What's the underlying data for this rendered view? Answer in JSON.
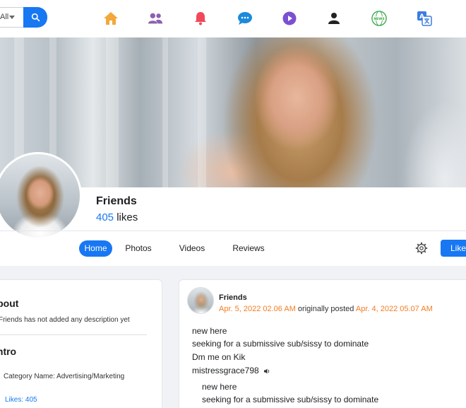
{
  "search": {
    "select_value": "All"
  },
  "nav": {
    "icons": [
      "home-icon",
      "friends-icon",
      "notifications-icon",
      "messages-icon",
      "video-icon",
      "profile-icon",
      "news-icon",
      "translate-icon"
    ],
    "news_badge": "NEWS"
  },
  "profile": {
    "name": "Friends",
    "likes_count": "405",
    "likes_label": "likes"
  },
  "tabs": [
    {
      "label": "Home",
      "active": true
    },
    {
      "label": "Photos",
      "active": false
    },
    {
      "label": "Videos",
      "active": false
    },
    {
      "label": "Reviews",
      "active": false
    }
  ],
  "like_button": "Like",
  "about": {
    "title": "About",
    "description": "Friends has not added any description yet",
    "intro_title": "Intro",
    "category": "Category Name: Advertising/Marketing",
    "likes": "Likes: 405"
  },
  "post": {
    "author": "Friends",
    "date_posted": "Apr. 5, 2022 02.06 AM",
    "originally_label": "originally posted",
    "date_original": "Apr. 4, 2022 05.07 AM",
    "lines": [
      "new here",
      "seeking for a submissive sub/sissy to dominate",
      "Dm me on Kik",
      "mistressgrace798"
    ],
    "nested_lines": [
      "new here",
      "seeking for a submissive sub/sissy to dominate"
    ]
  },
  "colors": {
    "accent": "#1877f2",
    "orange": "#f47c20"
  }
}
